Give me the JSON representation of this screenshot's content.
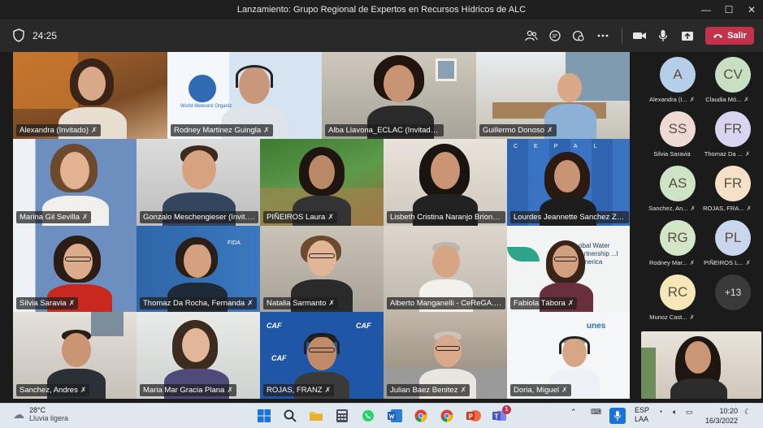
{
  "window": {
    "title": "Lanzamiento: Grupo Regional de Expertos en Recursos Hídricos de ALC",
    "minimize": "—",
    "maximize": "☐",
    "close": "✕"
  },
  "toolbar": {
    "timer": "24:25",
    "leave_label": "Salir",
    "icons": [
      "people-icon",
      "chat-icon",
      "reactions-icon",
      "more-icon",
      "camera-icon",
      "mic-icon",
      "share-icon"
    ],
    "accent": "#c4314b"
  },
  "grid": {
    "participants": [
      {
        "name": "Alexandra (Invitado)"
      },
      {
        "name": "Rodney Martinez Guingla"
      },
      {
        "name": "Alba Llavona_ECLAC (Invitado)"
      },
      {
        "name": "Guillermo Donoso"
      },
      {
        "name": "Marina Gil Sevilla"
      },
      {
        "name": "Gonzalo Meschengieser (Invit..."
      },
      {
        "name": "PIÑEIROS Laura"
      },
      {
        "name": "Lisbeth Cristina Naranjo Briones"
      },
      {
        "name": "Lourdes Jeannette Sanchez Z..."
      },
      {
        "name": "Silvia Saravia"
      },
      {
        "name": "Thomaz Da Rocha, Fernanda"
      },
      {
        "name": "Natalia Sarmanto"
      },
      {
        "name": "Alberto Manganelli - CeReGA..."
      },
      {
        "name": "Fabiola Tábora"
      },
      {
        "name": "Sanchez, Andres"
      },
      {
        "name": "Maria Mar Gracia Plana"
      },
      {
        "name": "ROJAS, FRANZ"
      },
      {
        "name": "Julian Baez Benitez"
      },
      {
        "name": "Doria, Miguel"
      }
    ],
    "backgrounds": {
      "wmo_text": "World Meteorol Organiz",
      "caf": "CAF",
      "fida": "FIDA",
      "cepal": "CEPAL",
      "gwp_text": "obal Water ...rtnership ...l America",
      "unesco": "unes"
    }
  },
  "roster": {
    "people": [
      {
        "initials": "A",
        "name": "Alexandra (I...",
        "color": "#b6cfe8"
      },
      {
        "initials": "CV",
        "name": "Claudia Mó...",
        "color": "#c9dfc4"
      },
      {
        "initials": "SS",
        "name": "Silvia Saravia",
        "color": "#efd9d4"
      },
      {
        "initials": "FR",
        "name": "Thomaz Da ...",
        "color": "#d9d4ef"
      },
      {
        "initials": "AS",
        "name": "Sanchez, An...",
        "color": "#cfe3c6"
      },
      {
        "initials": "FR",
        "name": "ROJAS, FRA...",
        "color": "#f5e0c8"
      },
      {
        "initials": "RG",
        "name": "Rodney Mar...",
        "color": "#d3e6c8"
      },
      {
        "initials": "PL",
        "name": "PIÑEIROS L...",
        "color": "#c9d6ee"
      },
      {
        "initials": "RC",
        "name": "Munoz Cast...",
        "color": "#f5e7b8"
      },
      {
        "initials": "+13",
        "name": "",
        "color": "#3a3a3a"
      }
    ]
  },
  "taskbar": {
    "temperature": "28°C",
    "condition": "Lluvia ligera",
    "language_line1": "ESP",
    "language_line2": "LAA",
    "time": "10:20",
    "date": "16/3/2022",
    "teams_badge": "1"
  }
}
